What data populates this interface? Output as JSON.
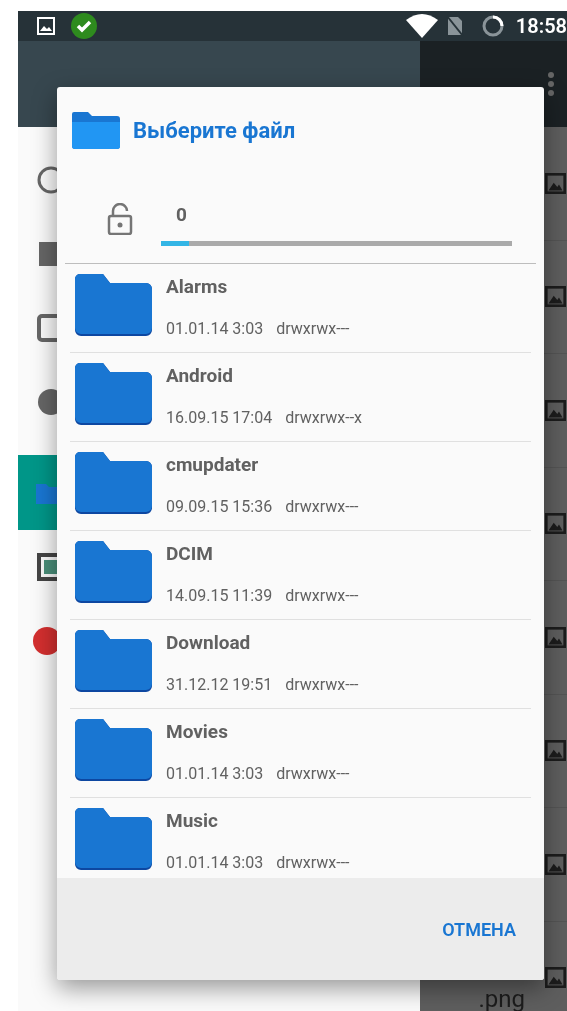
{
  "status_bar": {
    "time": "18:58"
  },
  "background": {
    "file_label": ".png"
  },
  "dialog": {
    "title": "Выберите файл",
    "path": {
      "text": "0",
      "level": 0.08
    },
    "items": [
      {
        "name": "Alarms",
        "date": "01.01.14 3:03",
        "permissions": "drwxrwx---"
      },
      {
        "name": "Android",
        "date": "16.09.15 17:04",
        "permissions": "drwxrwx--x"
      },
      {
        "name": "cmupdater",
        "date": "09.09.15 15:36",
        "permissions": "drwxrwx---"
      },
      {
        "name": "DCIM",
        "date": "14.09.15 11:39",
        "permissions": "drwxrwx---"
      },
      {
        "name": "Download",
        "date": "31.12.12 19:51",
        "permissions": "drwxrwx---"
      },
      {
        "name": "Movies",
        "date": "01.01.14 3:03",
        "permissions": "drwxrwx---"
      },
      {
        "name": "Music",
        "date": "01.01.14 3:03",
        "permissions": "drwxrwx---"
      }
    ],
    "buttons": [
      "ОТМЕНА"
    ]
  }
}
